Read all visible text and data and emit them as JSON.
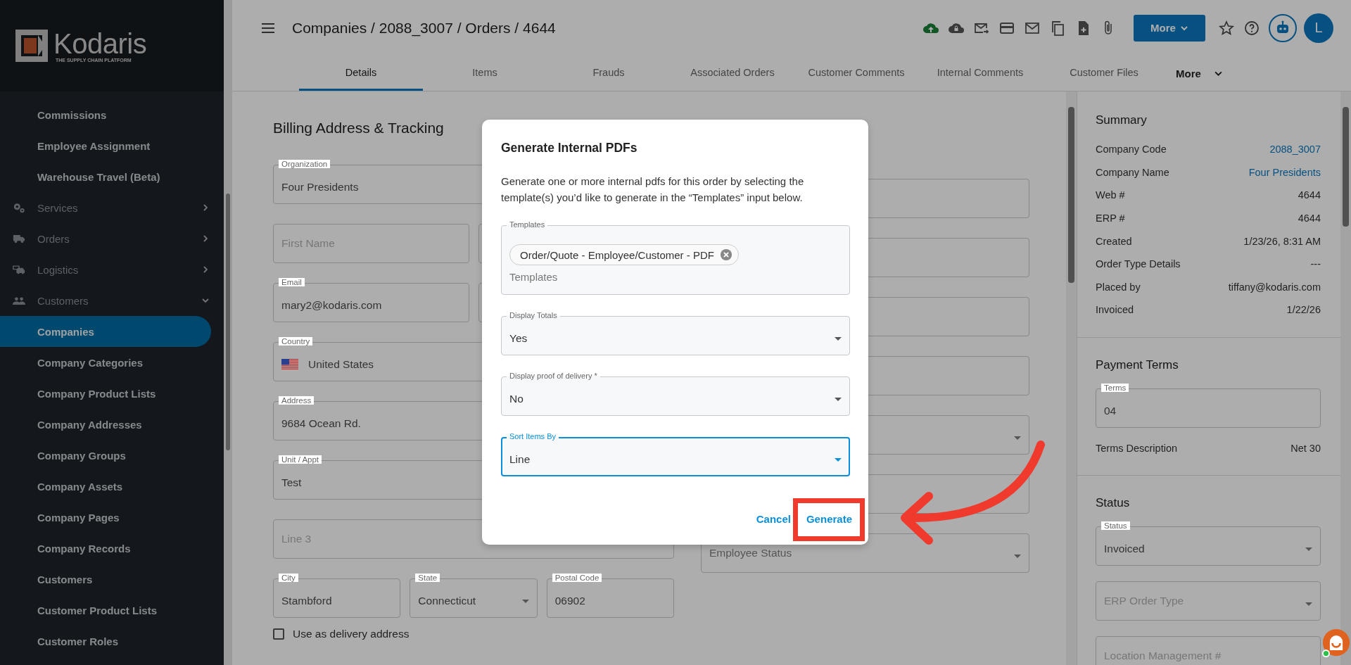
{
  "logo": {
    "name": "Kodaris",
    "tagline": "THE SUPPLY CHAIN PLATFORM"
  },
  "sidebar": {
    "items": [
      {
        "label": "Commissions",
        "kind": "sub",
        "selected": false
      },
      {
        "label": "Employee Assignment",
        "kind": "sub",
        "selected": false
      },
      {
        "label": "Warehouse Travel (Beta)",
        "kind": "sub",
        "selected": false
      },
      {
        "label": "Services",
        "kind": "group",
        "expanded": false
      },
      {
        "label": "Orders",
        "kind": "group",
        "expanded": false
      },
      {
        "label": "Logistics",
        "kind": "group",
        "expanded": false
      },
      {
        "label": "Customers",
        "kind": "group",
        "expanded": true
      },
      {
        "label": "Companies",
        "kind": "sub",
        "selected": true
      },
      {
        "label": "Company Categories",
        "kind": "sub",
        "selected": false
      },
      {
        "label": "Company Product Lists",
        "kind": "sub",
        "selected": false
      },
      {
        "label": "Company Addresses",
        "kind": "sub",
        "selected": false
      },
      {
        "label": "Company Groups",
        "kind": "sub",
        "selected": false
      },
      {
        "label": "Company Assets",
        "kind": "sub",
        "selected": false
      },
      {
        "label": "Company Pages",
        "kind": "sub",
        "selected": false
      },
      {
        "label": "Company Records",
        "kind": "sub",
        "selected": false
      },
      {
        "label": "Customers",
        "kind": "sub",
        "selected": false
      },
      {
        "label": "Customer Product Lists",
        "kind": "sub",
        "selected": false
      },
      {
        "label": "Customer Roles",
        "kind": "sub",
        "selected": false
      }
    ]
  },
  "header": {
    "breadcrumb": "Companies / 2088_3007 / Orders / 4644",
    "more_button": "More",
    "avatar": "L"
  },
  "tabs": [
    {
      "label": "Details",
      "selected": true
    },
    {
      "label": "Items",
      "selected": false
    },
    {
      "label": "Frauds",
      "selected": false
    },
    {
      "label": "Associated Orders",
      "selected": false
    },
    {
      "label": "Customer Comments",
      "selected": false
    },
    {
      "label": "Internal Comments",
      "selected": false
    },
    {
      "label": "Customer Files",
      "selected": false
    }
  ],
  "tabs_more": "More",
  "form": {
    "title": "Billing Address & Tracking",
    "left_rows": [
      [
        {
          "kind": "text",
          "label": "Organization",
          "value": "Four Presidents"
        }
      ],
      [
        {
          "kind": "text",
          "placeholder": "First Name"
        },
        {
          "kind": "text"
        }
      ],
      [
        {
          "kind": "text",
          "label": "Email",
          "value": "mary2@kodaris.com"
        },
        {
          "kind": "text"
        }
      ],
      [
        {
          "kind": "country",
          "label": "Country",
          "value": "United States"
        }
      ],
      [
        {
          "kind": "text",
          "label": "Address",
          "value": "9684 Ocean Rd."
        }
      ],
      [
        {
          "kind": "text",
          "label": "Unit / Appt",
          "value": "Test"
        }
      ],
      [
        {
          "kind": "text",
          "placeholder": "Line 3"
        }
      ],
      [
        {
          "kind": "text",
          "label": "City",
          "value": "Stambford"
        },
        {
          "kind": "select",
          "label": "State",
          "value": "Connecticut"
        },
        {
          "kind": "text",
          "label": "Postal Code",
          "value": "06902"
        }
      ]
    ],
    "right_fields": [
      {
        "kind": "text"
      },
      {
        "kind": "text"
      },
      {
        "kind": "text"
      },
      {
        "kind": "text"
      },
      {
        "kind": "select"
      },
      {
        "kind": "text"
      },
      {
        "kind": "select",
        "placeholder": "Employee Status"
      }
    ],
    "checkbox": {
      "label": "Use as delivery address",
      "checked": false
    }
  },
  "summary": {
    "title": "Summary",
    "rows": [
      {
        "label": "Company Code",
        "value": "2088_3007",
        "link": true
      },
      {
        "label": "Company Name",
        "value": "Four Presidents",
        "link": true
      },
      {
        "label": "Web #",
        "value": "4644",
        "link": false
      },
      {
        "label": "ERP #",
        "value": "4644",
        "link": false
      },
      {
        "label": "Created",
        "value": "1/23/26, 8:31 AM",
        "link": false
      },
      {
        "label": "Order Type Details",
        "value": "---",
        "link": false
      },
      {
        "label": "Placed by",
        "value": "tiffany@kodaris.com",
        "link": false
      },
      {
        "label": "Invoiced",
        "value": "1/22/26",
        "link": false
      }
    ]
  },
  "payment_terms": {
    "title": "Payment Terms",
    "field": {
      "kind": "text",
      "label": "Terms",
      "value": "04"
    },
    "rows": [
      {
        "label": "Terms Description",
        "value": "Net 30"
      }
    ]
  },
  "status": {
    "title": "Status",
    "fields": [
      {
        "kind": "select",
        "label": "Status",
        "value": "Invoiced"
      },
      {
        "kind": "select",
        "placeholder": "ERP Order Type"
      },
      {
        "kind": "text",
        "placeholder": "Location Management #"
      }
    ]
  },
  "modal": {
    "title": "Generate Internal PDFs",
    "description": "Generate one or more internal pdfs for this order by selecting the template(s) you’d like to generate in the “Templates” input below.",
    "fields": [
      {
        "kind": "chips",
        "label": "Templates",
        "chips": [
          "Order/Quote - Employee/Customer - PDF"
        ],
        "placeholder": "Templates",
        "focused": false
      },
      {
        "kind": "select",
        "label": "Display Totals",
        "value": "Yes",
        "focused": false
      },
      {
        "kind": "select",
        "label": "Display proof of delivery *",
        "value": "No",
        "focused": false
      },
      {
        "kind": "select",
        "label": "Sort Items By",
        "value": "Line",
        "focused": true
      }
    ],
    "buttons": [
      "Cancel",
      "Generate"
    ]
  }
}
